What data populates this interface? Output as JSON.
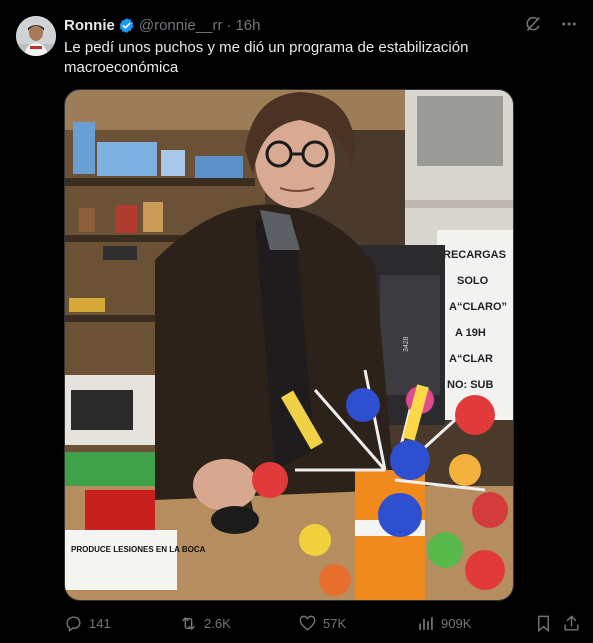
{
  "tweet": {
    "author_name": "Ronnie",
    "handle": "@ronnie__rr",
    "separator": "·",
    "time": "16h",
    "text": "Le pedí unos puchos y me dió un programa de estabilización macroeconómica",
    "image": {
      "sign_lines": [
        "RECARGAS",
        "SOLO",
        "A“CLARO”",
        "A 19H",
        "A“CLAR",
        "NO: SUB"
      ],
      "box_label": "PRODUCE LESIONES EN LA BOCA",
      "monitor_tag": "3428"
    }
  },
  "actions": {
    "replies": "141",
    "retweets": "2.6K",
    "likes": "57K",
    "views": "909K"
  },
  "colors": {
    "background": "#000000",
    "text": "#e7e9ea",
    "secondary": "#71767b",
    "verified": "#1d9bf0"
  },
  "icons": [
    "avatar",
    "verified-badge-icon",
    "grok-icon",
    "more-icon",
    "reply-icon",
    "retweet-icon",
    "like-icon",
    "views-icon",
    "bookmark-icon",
    "share-icon"
  ]
}
